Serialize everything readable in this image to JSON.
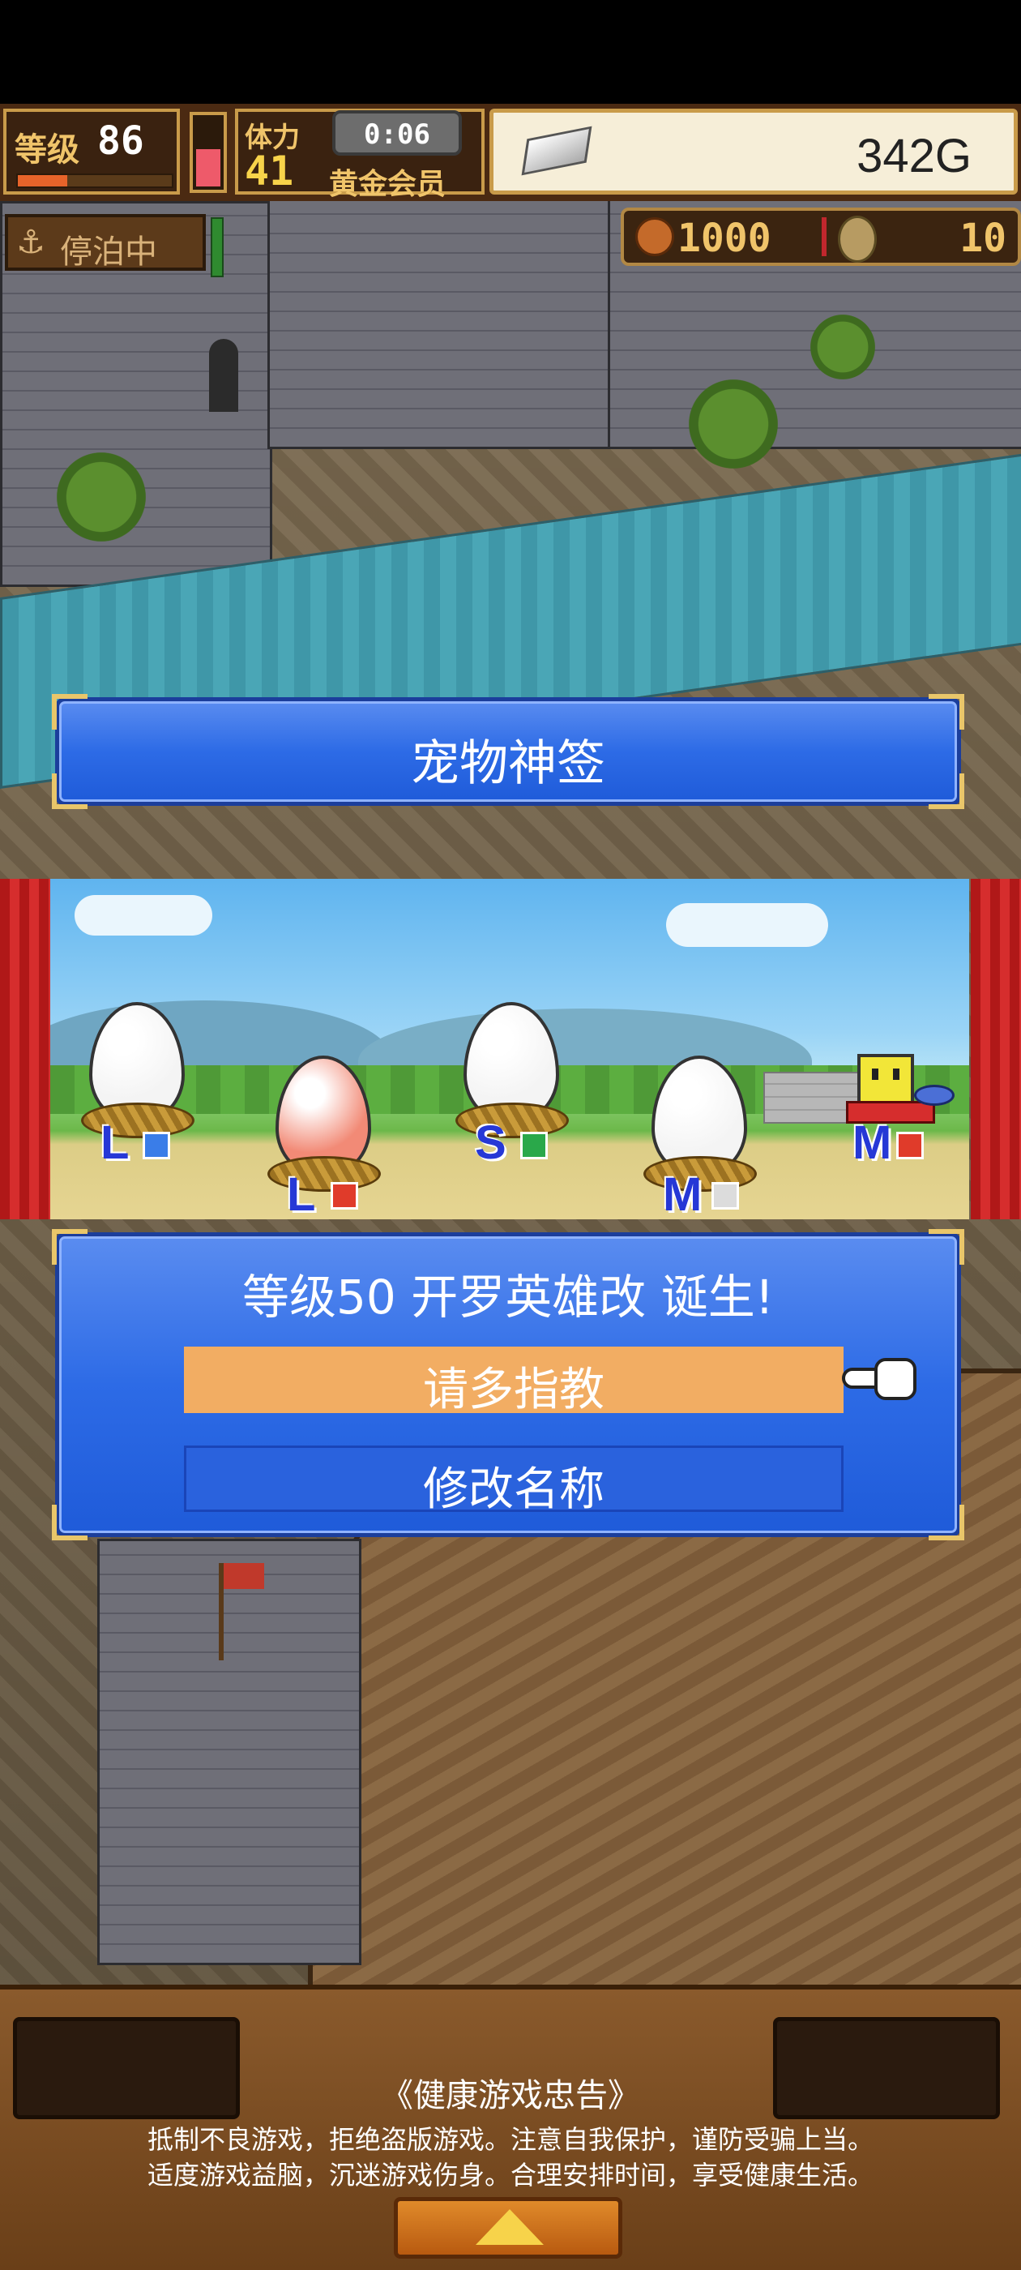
{
  "hud": {
    "level_label": "等级",
    "level_value": "86",
    "stamina_label": "体力",
    "stamina_value": "41",
    "timer": "0:06",
    "membership": "黄金会员",
    "money": "342G"
  },
  "status": {
    "anchor_text": "停泊中",
    "food_value": "1000",
    "coin_value": "10"
  },
  "dialog_top": {
    "title": "宠物神签"
  },
  "pets": [
    {
      "size": "L",
      "egg_color": "#f4f4f4",
      "element_color": "#3a7de8"
    },
    {
      "size": "L",
      "egg_color": "#f28a76",
      "element_color": "#e03b2a"
    },
    {
      "size": "S",
      "egg_color": "#f4f4f4",
      "element_color": "#2aa84a"
    },
    {
      "size": "M",
      "egg_color": "#f4f4f4",
      "element_color": "#dcdcdc"
    },
    {
      "size": "M",
      "egg_color": null,
      "element_color": "#e03b2a"
    }
  ],
  "dialog_main": {
    "message": "等级50 开罗英雄改 诞生!",
    "option_1": "请多指教",
    "option_2": "修改名称"
  },
  "notice": {
    "title": "《健康游戏忠告》",
    "line1": "抵制不良游戏，拒绝盗版游戏。注意自我保护，谨防受骗上当。",
    "line2": "适度游戏益脑，沉迷游戏伤身。合理安排时间，享受健康生活。"
  },
  "colors": {
    "highlight_option": "#f2ad63",
    "dialog_blue": "#2d6be6",
    "gold_border": "#e9c66a"
  }
}
